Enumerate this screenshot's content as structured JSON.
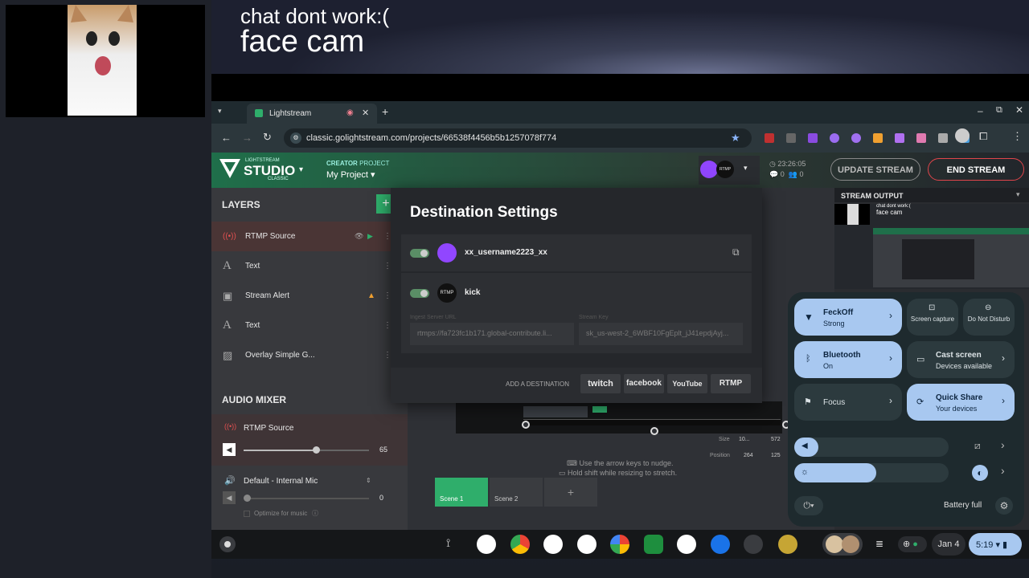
{
  "overlay": {
    "chat_text": "chat dont work:(",
    "face_cam_text": "face cam"
  },
  "browser": {
    "tab_title": "Lightstream",
    "url": "classic.golightstream.com/projects/66538f4456b5b1257078f774"
  },
  "app": {
    "logo_small": "LIGHTSTREAM",
    "logo_big": "STUDIO",
    "logo_sub": "CLASSIC",
    "creator_label": "CREATOR",
    "project_label": "PROJECT",
    "project_name": "My Project",
    "rtmp_badge": "RTMP",
    "time": "23:26:05",
    "stat1": "0",
    "stat2": "0",
    "update_stream": "UPDATE STREAM",
    "end_stream": "END STREAM",
    "stream_output": "STREAM OUTPUT",
    "layers_title": "LAYERS",
    "layers": [
      {
        "label": "RTMP Source"
      },
      {
        "label": "Text"
      },
      {
        "label": "Stream Alert"
      },
      {
        "label": "Text"
      },
      {
        "label": "Overlay Simple G..."
      }
    ],
    "audio_title": "AUDIO MIXER",
    "audio": [
      {
        "label": "RTMP Source",
        "value": "65"
      },
      {
        "label": "Default - Internal Mic",
        "value": "0"
      }
    ],
    "optimize_music": "Optimize for music",
    "nudge_hint": "Use the arrow keys to nudge.",
    "shift_hint": "Hold shift while resizing to stretch.",
    "scenes": [
      "Scene 1",
      "Scene 2"
    ],
    "size_label": "Size",
    "size_w": "10...",
    "size_h": "572",
    "position_label": "Position",
    "pos_x": "264",
    "pos_y": "125"
  },
  "modal": {
    "title": "Destination Settings",
    "dest1": "xx_username2223_xx",
    "dest2": "kick",
    "dest2_badge": "RTMP",
    "ingest_label": "Ingest Server URL",
    "ingest_value": "rtmps://fa723fc1b171.global-contribute.li...",
    "key_label": "Stream Key",
    "key_value": "sk_us-west-2_6WBF10FgEplt_jJ41epdjAyj...",
    "add_dest": "ADD A DESTINATION",
    "platforms": [
      "twitch",
      "facebook",
      "YouTube",
      "RTMP"
    ]
  },
  "quick_settings": {
    "wifi_title": "FeckOff",
    "wifi_sub": "Strong",
    "screen_capture": "Screen capture",
    "dnd": "Do Not Disturb",
    "bt_title": "Bluetooth",
    "bt_sub": "On",
    "cast_title": "Cast screen",
    "cast_sub": "Devices available",
    "focus": "Focus",
    "quick_share_title": "Quick Share",
    "quick_share_sub": "Your devices",
    "volume_level": 0.1,
    "brightness_level": 0.35,
    "battery": "Battery full"
  },
  "shelf": {
    "date": "Jan 4",
    "time": "5:19"
  },
  "colors": {
    "accent_green": "#2fae6b",
    "end_red": "#e0454b",
    "qs_blue": "#a8c8f0",
    "twitch": "#9146ff"
  }
}
